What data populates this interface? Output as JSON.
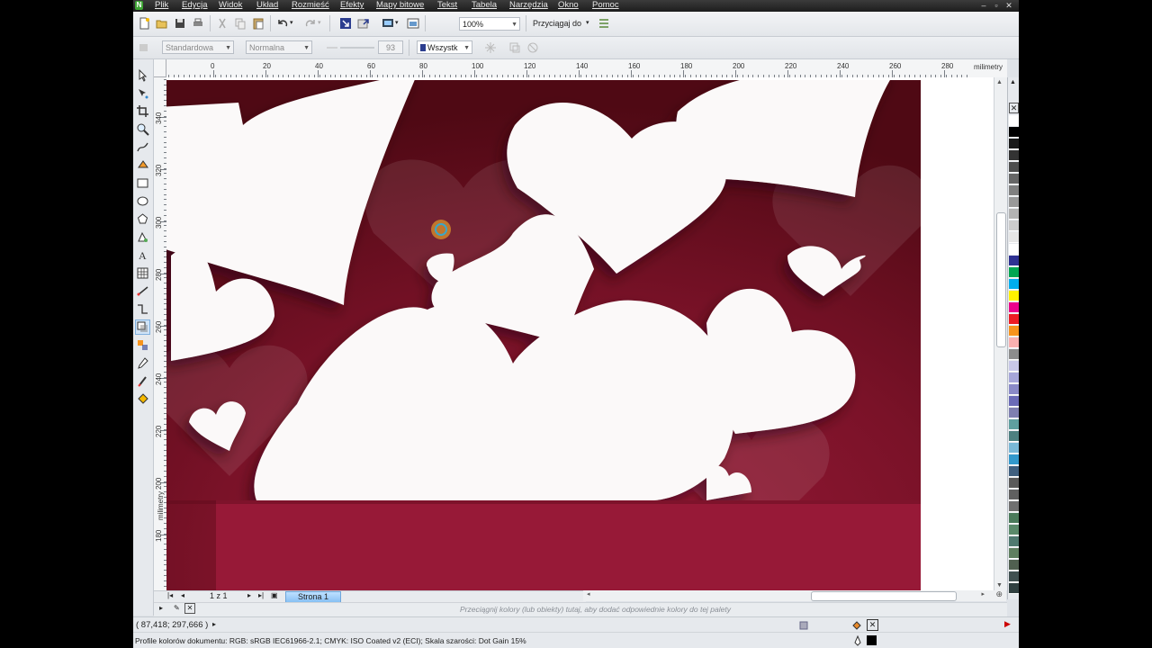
{
  "menubar": {
    "items": [
      "Plik",
      "Edycja",
      "Widok",
      "Układ",
      "Rozmieść",
      "Efekty",
      "Mapy bitowe",
      "Tekst",
      "Tabela",
      "Narzędzia",
      "Okno",
      "Pomoc"
    ]
  },
  "toolbar": {
    "zoom_value": "100%",
    "snap_label": "Przyciągaj do"
  },
  "property_bar": {
    "preset": "Standardowa",
    "mode": "Normalna",
    "value": "93",
    "target": "Wszystk"
  },
  "ruler": {
    "unit": "milimetry",
    "h_ticks": [
      "0",
      "20",
      "40",
      "60",
      "80",
      "100",
      "120",
      "140",
      "160",
      "180",
      "200",
      "220",
      "240",
      "260",
      "280"
    ],
    "v_ticks": [
      "340",
      "320",
      "300",
      "280",
      "260",
      "240",
      "220",
      "200",
      "180"
    ]
  },
  "page_nav": {
    "counter": "1 z 1",
    "tab_label": "Strona 1"
  },
  "hint": "Przeciągnij kolory (lub obiekty) tutaj, aby dodać odpowiednie kolory do tej palety",
  "status": {
    "coords": "( 87,418; 297,666 )",
    "profile": "Profile kolorów dokumentu: RGB: sRGB IEC61966-2.1; CMYK: ISO Coated v2 (ECI); Skala szarości: Dot Gain 15%"
  },
  "colors": {
    "background_dark": "#6b0f1e",
    "background_mid": "#8b1a2e",
    "heart": "#fbf9f9"
  },
  "palette": [
    "#ffffff",
    "#000000",
    "#1a1a1a",
    "#333333",
    "#4d4d4d",
    "#666666",
    "#808080",
    "#999999",
    "#b3b3b3",
    "#cccccc",
    "#e6e6e6",
    "#ffffff",
    "#2e3192",
    "#00a651",
    "#00aeef",
    "#fff200",
    "#ec008c",
    "#ed1c24",
    "#f7941d",
    "#f9b0b0",
    "#8c8c8c",
    "#c8c8e8",
    "#a6a6d9",
    "#8a8ac8",
    "#6b6bb8",
    "#7f7fb0",
    "#5f9f9f",
    "#4d8080",
    "#79b8d6",
    "#3399cc",
    "#406080",
    "#5a5a5a",
    "#606060",
    "#707070",
    "#4a7a5a",
    "#5a8a6a",
    "#507a70",
    "#5f7f60",
    "#506050",
    "#405050",
    "#304040"
  ]
}
